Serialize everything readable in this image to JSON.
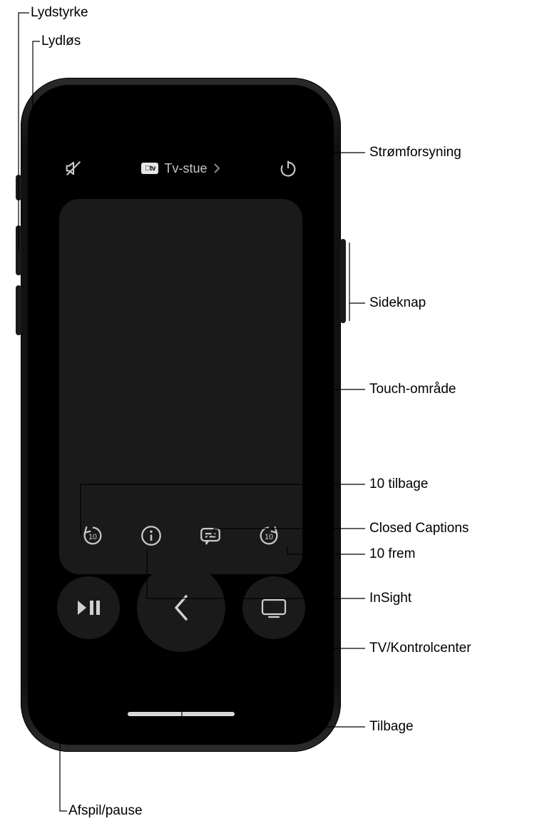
{
  "header": {
    "device_label": "Tv-stue"
  },
  "callouts": {
    "lydstyrke": "Lydstyrke",
    "lydlos": "Lydløs",
    "strom": "Strømforsyning",
    "sideknap": "Sideknap",
    "touch": "Touch-område",
    "ten_back": "10 tilbage",
    "cc": "Closed Captions",
    "ten_fwd": "10 frem",
    "insight": "InSight",
    "tv_ctrl": "TV/Kontrolcenter",
    "tilbage": "Tilbage",
    "afspil": "Afspil/pause"
  },
  "icons": {
    "mute": "mute-icon",
    "power": "power-icon",
    "skip_back_10": "skip-back-10-icon",
    "info": "info-icon",
    "captions": "captions-icon",
    "skip_fwd_10": "skip-forward-10-icon",
    "play_pause": "play-pause-icon",
    "back_chevron": "chevron-left-icon",
    "tv": "tv-icon",
    "chevron_right": "chevron-right-icon",
    "appletv_badge": "apple-tv-badge"
  },
  "colors": {
    "panel": "#1a1a1a",
    "icon": "#c8c8c8",
    "bg": "#000000"
  }
}
